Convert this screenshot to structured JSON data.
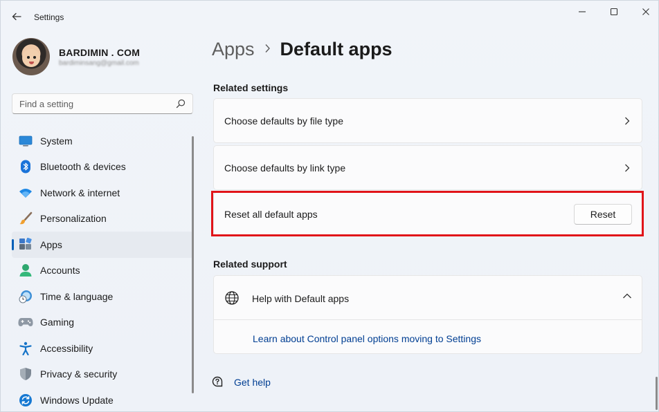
{
  "titlebar": {
    "app_title": "Settings"
  },
  "profile": {
    "name": "BARDIMIN . COM",
    "email": "bardiminsang@gmail.com"
  },
  "search": {
    "placeholder": "Find a setting"
  },
  "sidebar": {
    "items": [
      {
        "label": "System",
        "icon": "system-icon"
      },
      {
        "label": "Bluetooth & devices",
        "icon": "bluetooth-icon"
      },
      {
        "label": "Network & internet",
        "icon": "wifi-icon"
      },
      {
        "label": "Personalization",
        "icon": "brush-icon"
      },
      {
        "label": "Apps",
        "icon": "apps-icon",
        "selected": true
      },
      {
        "label": "Accounts",
        "icon": "person-icon"
      },
      {
        "label": "Time & language",
        "icon": "clock-globe-icon"
      },
      {
        "label": "Gaming",
        "icon": "gamepad-icon"
      },
      {
        "label": "Accessibility",
        "icon": "accessibility-icon"
      },
      {
        "label": "Privacy & security",
        "icon": "shield-icon"
      },
      {
        "label": "Windows Update",
        "icon": "update-icon"
      }
    ]
  },
  "breadcrumb": {
    "parent": "Apps",
    "current": "Default apps"
  },
  "related_settings": {
    "title": "Related settings",
    "items": [
      {
        "label": "Choose defaults by file type"
      },
      {
        "label": "Choose defaults by link type"
      },
      {
        "label": "Reset all default apps",
        "button": "Reset"
      }
    ]
  },
  "related_support": {
    "title": "Related support",
    "help_title": "Help with Default apps",
    "link": "Learn about Control panel options moving to Settings"
  },
  "footer": {
    "get_help": "Get help"
  },
  "colors": {
    "accent": "#005fb8",
    "link": "#003e92",
    "highlight": "#e11419"
  }
}
